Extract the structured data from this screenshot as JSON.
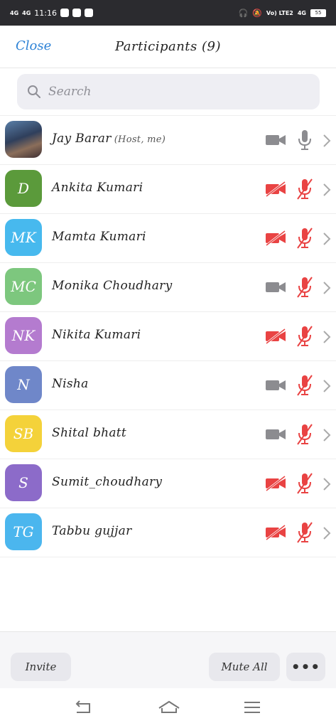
{
  "status_bar": {
    "network_1": "4G",
    "network_2": "4G",
    "time": "11:16",
    "lte_label": "Vo) LTE2",
    "net_speed": "4G",
    "battery": "55"
  },
  "header": {
    "close_label": "Close",
    "title": "Participants (9)"
  },
  "search": {
    "placeholder": "Search"
  },
  "participants": [
    {
      "name": "Jay Barar",
      "sub": "(Host, me)",
      "avatar_type": "photo",
      "initials": "",
      "avatar_color": "",
      "video_muted": false,
      "audio_muted": false
    },
    {
      "name": "Ankita Kumari",
      "sub": "",
      "avatar_type": "initials",
      "initials": "D",
      "avatar_color": "#5b9a3b",
      "video_muted": true,
      "audio_muted": true
    },
    {
      "name": "Mamta Kumari",
      "sub": "",
      "avatar_type": "initials",
      "initials": "MK",
      "avatar_color": "#47b9ee",
      "video_muted": true,
      "audio_muted": true
    },
    {
      "name": "Monika Choudhary",
      "sub": "",
      "avatar_type": "initials",
      "initials": "MC",
      "avatar_color": "#7dc77e",
      "video_muted": false,
      "audio_muted": true
    },
    {
      "name": "Nikita Kumari",
      "sub": "",
      "avatar_type": "initials",
      "initials": "NK",
      "avatar_color": "#b47bcf",
      "video_muted": true,
      "audio_muted": true
    },
    {
      "name": "Nisha",
      "sub": "",
      "avatar_type": "initials",
      "initials": "N",
      "avatar_color": "#6f87c9",
      "video_muted": false,
      "audio_muted": true
    },
    {
      "name": "Shital bhatt",
      "sub": "",
      "avatar_type": "initials",
      "initials": "SB",
      "avatar_color": "#f4d23a",
      "video_muted": false,
      "audio_muted": true
    },
    {
      "name": "Sumit_choudhary",
      "sub": "",
      "avatar_type": "initials",
      "initials": "S",
      "avatar_color": "#8c6bc9",
      "video_muted": true,
      "audio_muted": true
    },
    {
      "name": "Tabbu gujjar",
      "sub": "",
      "avatar_type": "initials",
      "initials": "TG",
      "avatar_color": "#4bb6ee",
      "video_muted": true,
      "audio_muted": true
    }
  ],
  "footer": {
    "invite_label": "Invite",
    "mute_all_label": "Mute All",
    "more_label": "•••"
  },
  "colors": {
    "accent": "#2f83d6",
    "muted_red": "#e94343",
    "icon_gray": "#8c8c90"
  }
}
